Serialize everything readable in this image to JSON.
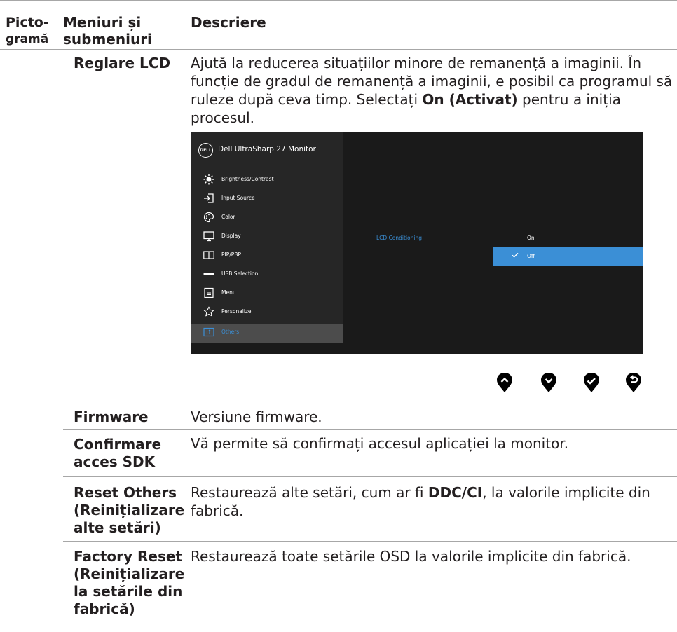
{
  "header": {
    "col_icon": "Picto-\ngramă",
    "col_icon_l1": "Picto-",
    "col_icon_l2": "gramă",
    "col_menu_l1": "Meniuri și",
    "col_menu_l2": "submeniuri",
    "col_desc": "Descriere"
  },
  "rows": {
    "lcd": {
      "name": "Reglare LCD",
      "desc_pre": "Ajută la reducerea situațiilor minore de remanență a imaginii. În funcție de gradul de remanență a imaginii, e posibil ca programul să ruleze după ceva timp. Selectați ",
      "desc_bold": "On (Activat)",
      "desc_post": " pentru a iniția procesul."
    },
    "firmware": {
      "name": "Firmware",
      "desc": "Versiune firmware."
    },
    "sdk": {
      "name_l1": "Confirmare",
      "name_l2": "acces SDK",
      "desc": "Vă permite să confirmați accesul aplicației la monitor."
    },
    "reset_others": {
      "name_l1": "Reset Others",
      "name_l2": "(Reinițializare",
      "name_l3": "alte setări)",
      "desc_pre": "Restaurează alte setări, cum ar fi ",
      "desc_bold": "DDC/CI",
      "desc_post": ", la valorile implicite din fabrică."
    },
    "factory_reset": {
      "name_l1": "Factory Reset",
      "name_l2": "(Reinițializare",
      "name_l3": "la setările din",
      "name_l4": "fabrică)",
      "desc": "Restaurează toate setările OSD la valorile implicite din fabrică."
    }
  },
  "osd": {
    "logo": "DELL",
    "title": "Dell UltraSharp 27 Monitor",
    "menu": [
      {
        "label": "Brightness/Contrast",
        "icon": "brightness-icon"
      },
      {
        "label": "Input Source",
        "icon": "input-source-icon"
      },
      {
        "label": "Color",
        "icon": "color-palette-icon"
      },
      {
        "label": "Display",
        "icon": "display-icon"
      },
      {
        "label": "PIP/PBP",
        "icon": "pip-pbp-icon"
      },
      {
        "label": "USB Selection",
        "icon": "usb-icon"
      },
      {
        "label": "Menu",
        "icon": "menu-icon"
      },
      {
        "label": "Personalize",
        "icon": "star-icon"
      },
      {
        "label": "Others",
        "icon": "others-icon"
      }
    ],
    "selected_item": "Others",
    "option_label": "LCD Conditioning",
    "option_on": "On",
    "option_off": "Off",
    "option_selected": "Off",
    "accent_color": "#3b8fd6"
  },
  "buttons": [
    "up-arrow-icon",
    "down-arrow-icon",
    "check-icon",
    "back-icon"
  ]
}
